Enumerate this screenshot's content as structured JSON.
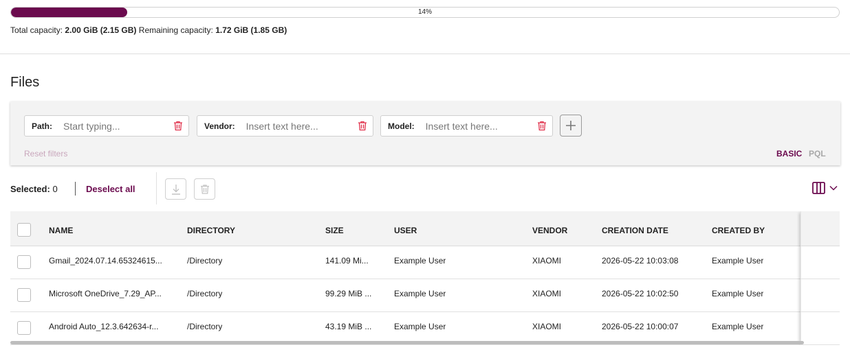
{
  "capacity": {
    "percent_text": "14%",
    "percent": 14,
    "total_label": "Total capacity:",
    "total_value": "2.00 GiB (2.15 GB)",
    "remaining_label": "Remaining capacity:",
    "remaining_value": "1.72 GiB (1.85 GB)"
  },
  "files": {
    "title": "Files"
  },
  "filters": {
    "path": {
      "label": "Path:",
      "placeholder": "Start typing..."
    },
    "vendor": {
      "label": "Vendor:",
      "placeholder": "Insert text here..."
    },
    "model": {
      "label": "Model:",
      "placeholder": "Insert text here..."
    },
    "add_icon": "plus-icon",
    "reset_label": "Reset filters",
    "mode_basic": "BASIC",
    "mode_pql": "PQL"
  },
  "selection": {
    "selected_label": "Selected:",
    "selected_count": "0",
    "deselect_label": "Deselect all"
  },
  "table": {
    "headers": {
      "name": "NAME",
      "directory": "DIRECTORY",
      "size": "SIZE",
      "user": "USER",
      "vendor": "VENDOR",
      "creation_date": "CREATION DATE",
      "created_by": "CREATED BY"
    },
    "rows": [
      {
        "name": "Gmail_2024.07.14.65324615...",
        "directory": "/Directory",
        "size": "141.09 Mi...",
        "user": "Example User",
        "vendor": "XIAOMI",
        "creation_date": "2026-05-22 10:03:08",
        "created_by": "Example User"
      },
      {
        "name": "Microsoft OneDrive_7.29_AP...",
        "directory": "/Directory",
        "size": "99.29 MiB ...",
        "user": "Example User",
        "vendor": "XIAOMI",
        "creation_date": "2026-05-22 10:02:50",
        "created_by": "Example User"
      },
      {
        "name": "Android Auto_12.3.642634-r...",
        "directory": "/Directory",
        "size": "43.19 MiB ...",
        "user": "Example User",
        "vendor": "XIAOMI",
        "creation_date": "2026-05-22 10:00:07",
        "created_by": "Example User"
      }
    ]
  },
  "colors": {
    "accent": "#6b0a4e",
    "delete": "#e0304b"
  }
}
